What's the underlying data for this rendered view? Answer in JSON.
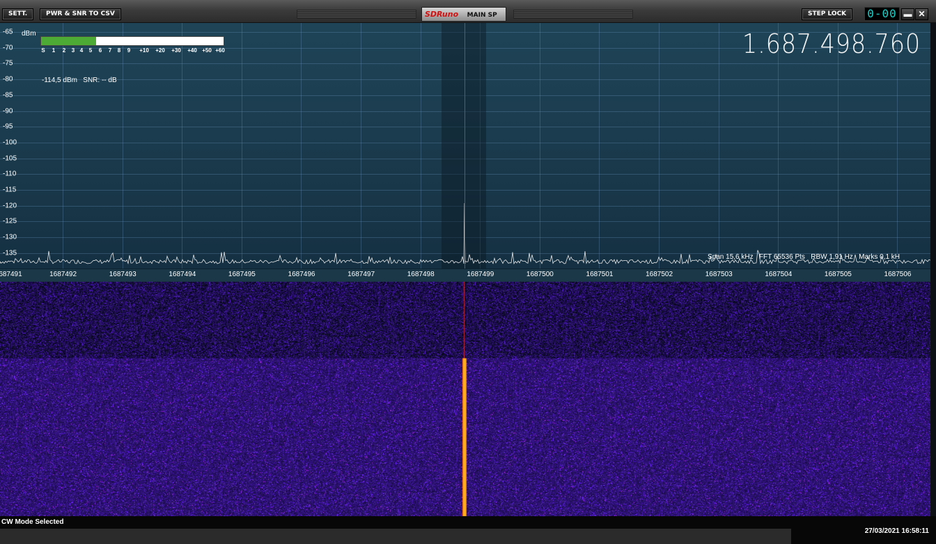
{
  "titlebar": {
    "settings_label": "SETT.",
    "csv_label": "PWR & SNR TO CSV",
    "brand_logo": "SDRuno",
    "window_name": "MAIN SP",
    "step_lock_label": "STEP LOCK",
    "step_counter": "0-00",
    "minimize_symbol": "▬",
    "close_symbol": "✕"
  },
  "spectrum": {
    "dbm_unit": "dBm",
    "y_ticks": [
      "-65",
      "-70",
      "-75",
      "-80",
      "-85",
      "-90",
      "-95",
      "-100",
      "-105",
      "-110",
      "-115",
      "-120",
      "-125",
      "-130",
      "-135"
    ],
    "smeter_scale": [
      "S",
      "1",
      "2",
      "3",
      "4",
      "5",
      "6",
      "7",
      "8",
      "9",
      "+10",
      "+20",
      "+30",
      "+40",
      "+50",
      "+60"
    ],
    "smeter_level_fraction": 0.3,
    "power_readout": "-114,5 dBm   SNR: -- dB",
    "frequency_display": "1.687.498.760",
    "info_line": "Span 15,6 kHz   FFT 65536 Pts   RBW 1,91 Hz   Marks 0,1 kH",
    "freq_ticks": [
      "687491",
      "1687492",
      "1687493",
      "1687494",
      "1687495",
      "1687496",
      "1687497",
      "1687498",
      "1687499",
      "1687500",
      "1687501",
      "1687502",
      "1687503",
      "1687504",
      "1687505",
      "1687506"
    ],
    "colors": {
      "trace": "#e8e8e8",
      "tune_line": "#d32a2a",
      "smeter_fill": "#4caa35",
      "signal": "#ffb020"
    }
  },
  "status": {
    "mode_text": "CW Mode Selected",
    "datetime": "27/03/2021 16:58:11"
  }
}
